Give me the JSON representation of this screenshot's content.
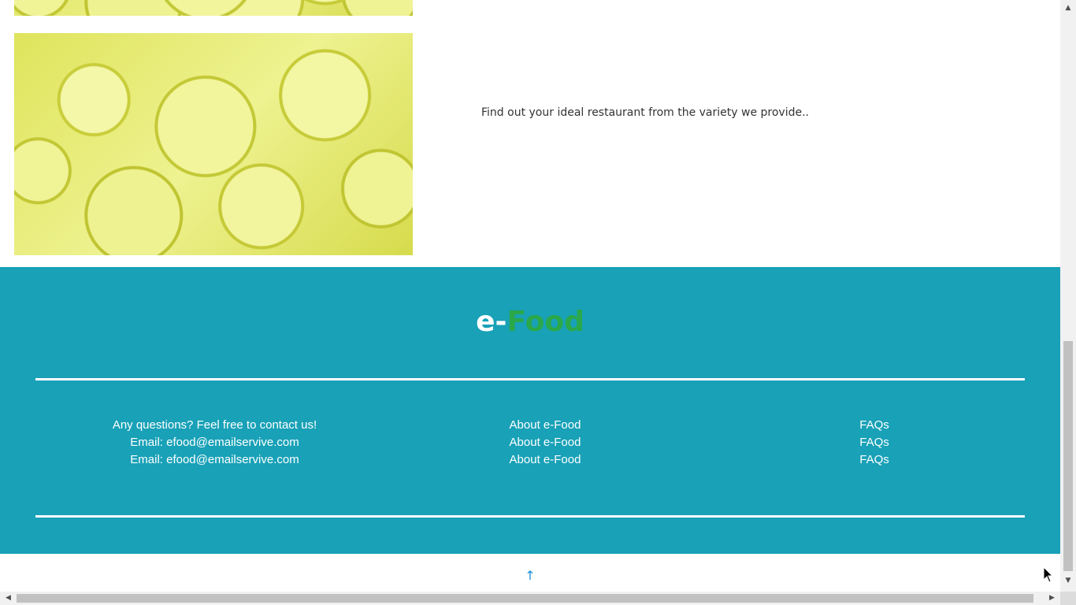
{
  "promo": {
    "text": "Find out your ideal restaurant from the variety we provide.."
  },
  "footer": {
    "brand_prefix": "e-",
    "brand_suffix": "Food",
    "contact": {
      "heading": "Any questions? Feel free to contact us!",
      "lines": [
        "Email: efood@emailservive.com",
        "Email: efood@emailservive.com"
      ]
    },
    "about_links": [
      "About e-Food",
      "About e-Food",
      "About e-Food"
    ],
    "faq_links": [
      "FAQs",
      "FAQs",
      "FAQs"
    ]
  },
  "back_to_top": {
    "icon": "arrow-up-icon",
    "glyph": "↑"
  },
  "colors": {
    "footer_bg": "#18a1b7",
    "brand_accent": "#2aa84a",
    "link_blue": "#1a8fd8"
  }
}
